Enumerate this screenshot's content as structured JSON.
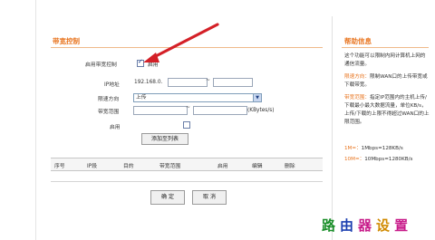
{
  "section": {
    "title": "带宽控制"
  },
  "form": {
    "enable_label": "启用带宽控制",
    "enable_checked": true,
    "enable_text": "启用",
    "ip_label": "IP地址",
    "ip_value": "192.168.0.",
    "ip_sep": "~",
    "direction_label": "限速方向",
    "direction_value": "上传",
    "range_label": "带宽范围",
    "range_sep": "~",
    "range_unit": "(KBytes/s)",
    "row_enable_label": "启用",
    "add_button": "添加至列表"
  },
  "table": {
    "headers": [
      "序号",
      "IP段",
      "目的",
      "带宽范围",
      "启用",
      "编辑",
      "删除"
    ]
  },
  "actions": {
    "ok": "确 定",
    "cancel": "取 消"
  },
  "help": {
    "title": "帮助信息",
    "p1": "这个功能可以限制内网计算机上网的通信流量。",
    "dir_key": "限速方向：",
    "dir_text": "限制WAN口的上传带宽或下载带宽。",
    "range_key": "带宽范围：",
    "range_text": "指定IP范围内的主机上传/下载最小最大数据流量，单位KB/s，上传/下载的上限不得超过WAN口的上限范围。",
    "ex1_key": "1M=：",
    "ex1_text": "1Mbps=128KB/s",
    "ex2_key": "10M=：",
    "ex2_text": "10Mbps=1280KB/s"
  },
  "watermark": {
    "c1": "路",
    "c2": "由",
    "c3": "器",
    "c4": "设",
    "c5": "置"
  },
  "colors": {
    "accent": "#e8741e",
    "arrow": "#d42027"
  }
}
